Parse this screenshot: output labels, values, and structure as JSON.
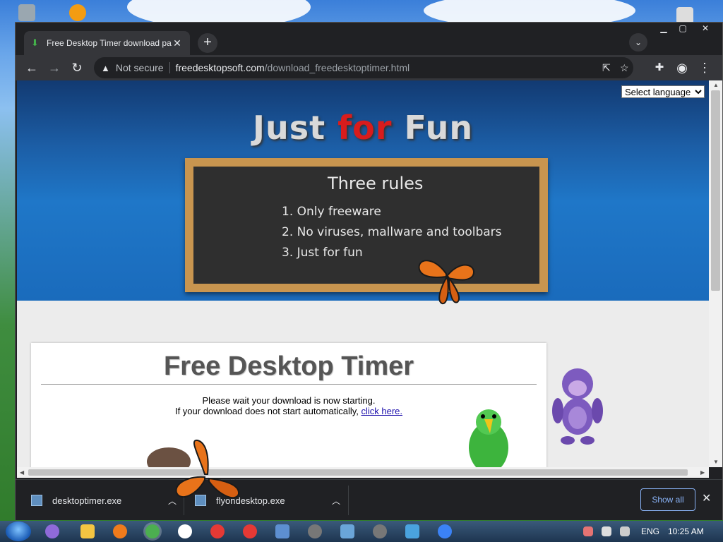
{
  "browser": {
    "tab_title": "Free Desktop Timer download pa",
    "tab_close": "✕",
    "new_tab": "+",
    "security_label": "Not secure",
    "url_host": "freedesktopsoft.com",
    "url_path": "/download_freedesktoptimer.html"
  },
  "page": {
    "language_select": "Select language",
    "banner": {
      "word1": "Just",
      "word2": "for",
      "word3": "Fun"
    },
    "chalkboard": {
      "heading": "Three rules",
      "rules": [
        "1. Only freeware",
        "2. No viruses, mallware and toolbars",
        "3. Just for fun"
      ]
    },
    "app_title": "Free Desktop Timer",
    "message_line1": "Please wait your download is now starting.",
    "message_line2": "If your download does not start automatically,",
    "click_here": "click here."
  },
  "downloads": {
    "items": [
      {
        "filename": "desktoptimer.exe"
      },
      {
        "filename": "flyondesktop.exe"
      }
    ],
    "show_all": "Show all",
    "close": "✕"
  },
  "taskbar": {
    "language": "ENG",
    "clock": "10:25 AM"
  },
  "colors": {
    "accent_red": "#d81c1c",
    "link": "#1a0dab",
    "show_all": "#8ab4f8"
  }
}
